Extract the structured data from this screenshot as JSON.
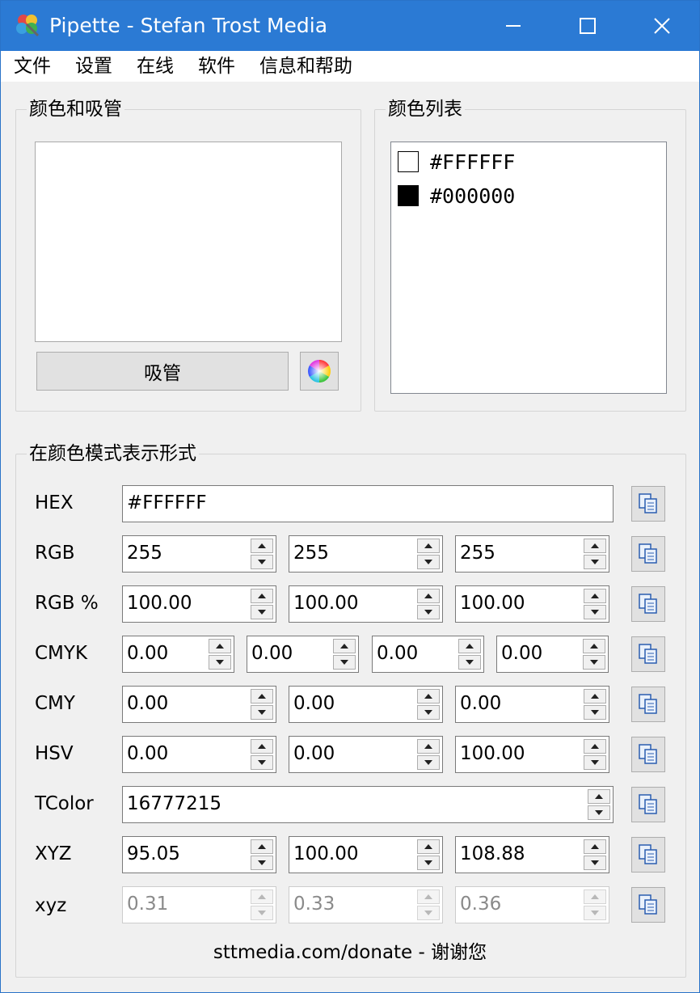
{
  "window": {
    "title": "Pipette - Stefan Trost Media",
    "controls": {
      "minimize": "minimize-icon",
      "maximize": "maximize-icon",
      "close": "close-icon"
    }
  },
  "menu": {
    "items": [
      "文件",
      "设置",
      "在线",
      "软件",
      "信息和帮助"
    ]
  },
  "picker": {
    "group_title": "颜色和吸管",
    "current_color": "#FFFFFF",
    "pipette_label": "吸管",
    "color_wheel_icon": "color-wheel-icon"
  },
  "color_list": {
    "group_title": "颜色列表",
    "items": [
      {
        "hex": "#FFFFFF",
        "swatch": "#FFFFFF"
      },
      {
        "hex": "#000000",
        "swatch": "#000000"
      }
    ]
  },
  "modes": {
    "group_title": "在颜色模式表示形式",
    "hex": {
      "label": "HEX",
      "value": "#FFFFFF"
    },
    "rgb": {
      "label": "RGB",
      "values": [
        "255",
        "255",
        "255"
      ]
    },
    "rgb_pct": {
      "label": "RGB %",
      "values": [
        "100.00",
        "100.00",
        "100.00"
      ]
    },
    "cmyk": {
      "label": "CMYK",
      "values": [
        "0.00",
        "0.00",
        "0.00",
        "0.00"
      ]
    },
    "cmy": {
      "label": "CMY",
      "values": [
        "0.00",
        "0.00",
        "0.00"
      ]
    },
    "hsv": {
      "label": "HSV",
      "values": [
        "0.00",
        "0.00",
        "100.00"
      ]
    },
    "tcolor": {
      "label": "TColor",
      "value": "16777215"
    },
    "xyz_upper": {
      "label": "XYZ",
      "values": [
        "95.05",
        "100.00",
        "108.88"
      ]
    },
    "xyz_lower": {
      "label": "xyz",
      "values": [
        "0.31",
        "0.33",
        "0.36"
      ]
    }
  },
  "footer": {
    "text": "sttmedia.com/donate - 谢谢您"
  },
  "colors": {
    "titlebar": "#2B7AD4",
    "window_bg": "#F0F0F0",
    "button_bg": "#E1E1E1"
  }
}
